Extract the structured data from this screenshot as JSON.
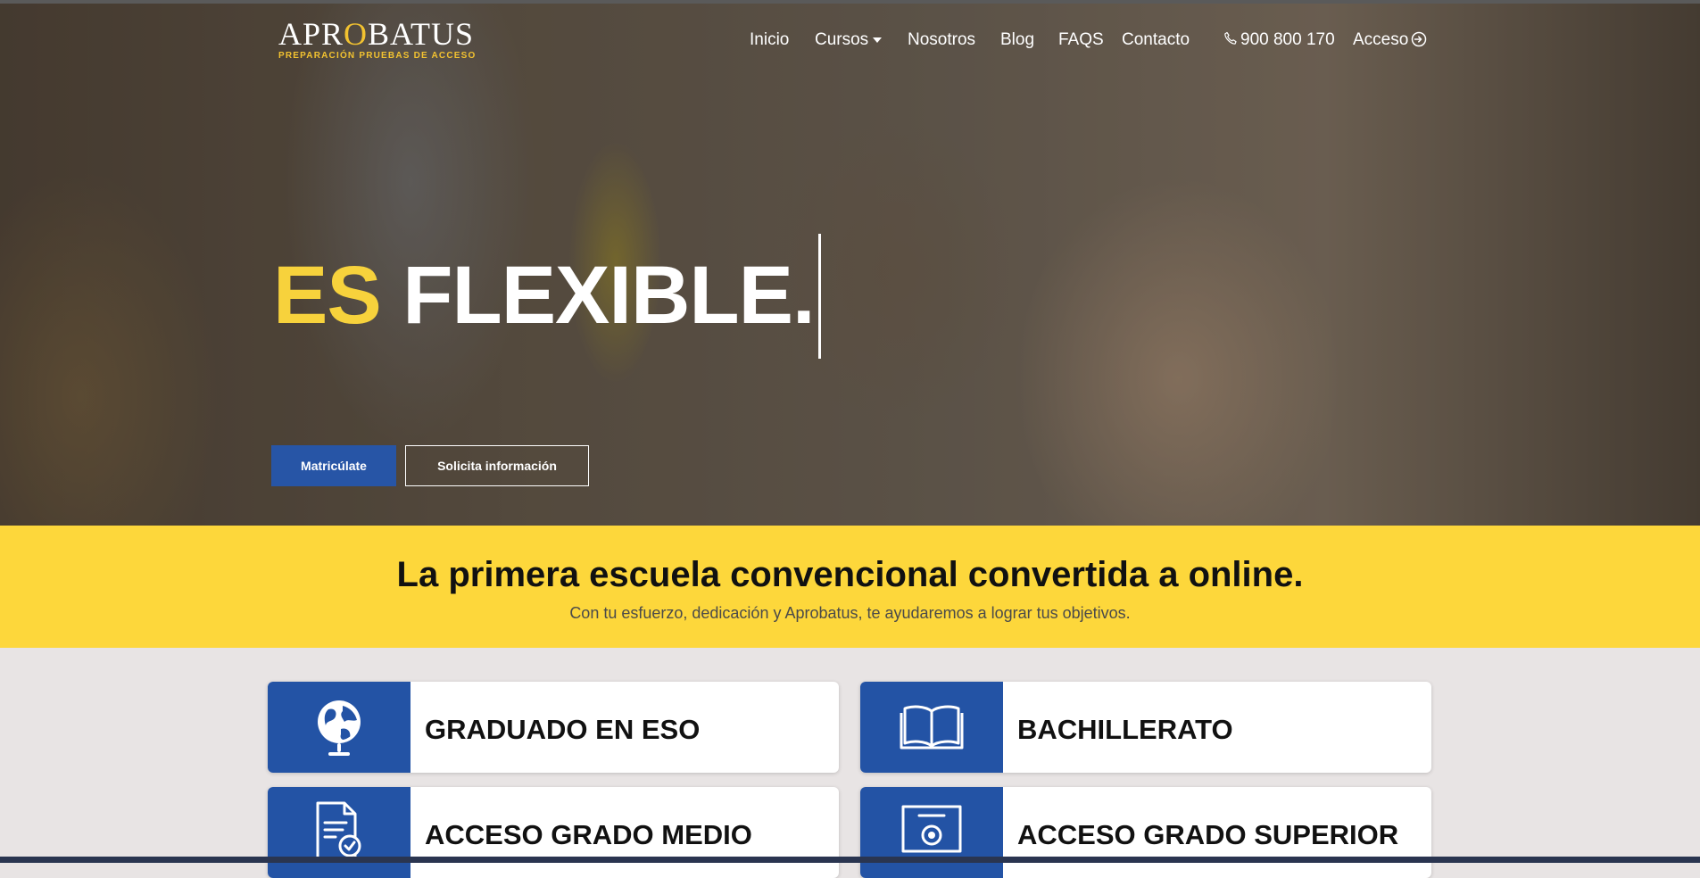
{
  "brand": {
    "logo_prefix": "APR",
    "logo_o": "O",
    "logo_suffix": "BATUS",
    "logo_tagline": "PREPARACIÓN PRUEBAS DE ACCESO",
    "accent_color": "#f7d23c",
    "primary_color": "#2755a6"
  },
  "nav": {
    "items": [
      {
        "label": "Inicio"
      },
      {
        "label": "Cursos",
        "has_dropdown": true
      },
      {
        "label": "Nosotros"
      },
      {
        "label": "Blog"
      },
      {
        "label": "FAQS"
      },
      {
        "label": "Contacto"
      }
    ],
    "phone": "900 800 170",
    "phone_icon": "phone-icon",
    "login": "Acceso",
    "login_icon": "login-icon"
  },
  "hero": {
    "headline_highlight": "ES",
    "headline_rest": "FLEXIBLE.",
    "primary_button": "Matricúlate",
    "secondary_button": "Solicita información"
  },
  "banner": {
    "title": "La primera escuela convencional convertida a online.",
    "subtitle": "Con tu esfuerzo, dedicación y Aprobatus, te ayudaremos a lograr tus objetivos."
  },
  "courses": [
    {
      "label": "GRADUADO EN ESO",
      "icon": "globe-icon"
    },
    {
      "label": "BACHILLERATO",
      "icon": "book-icon"
    },
    {
      "label": "ACCESO GRADO MEDIO",
      "icon": "document-badge-icon"
    },
    {
      "label": "ACCESO GRADO SUPERIOR",
      "icon": "certificate-icon"
    }
  ]
}
